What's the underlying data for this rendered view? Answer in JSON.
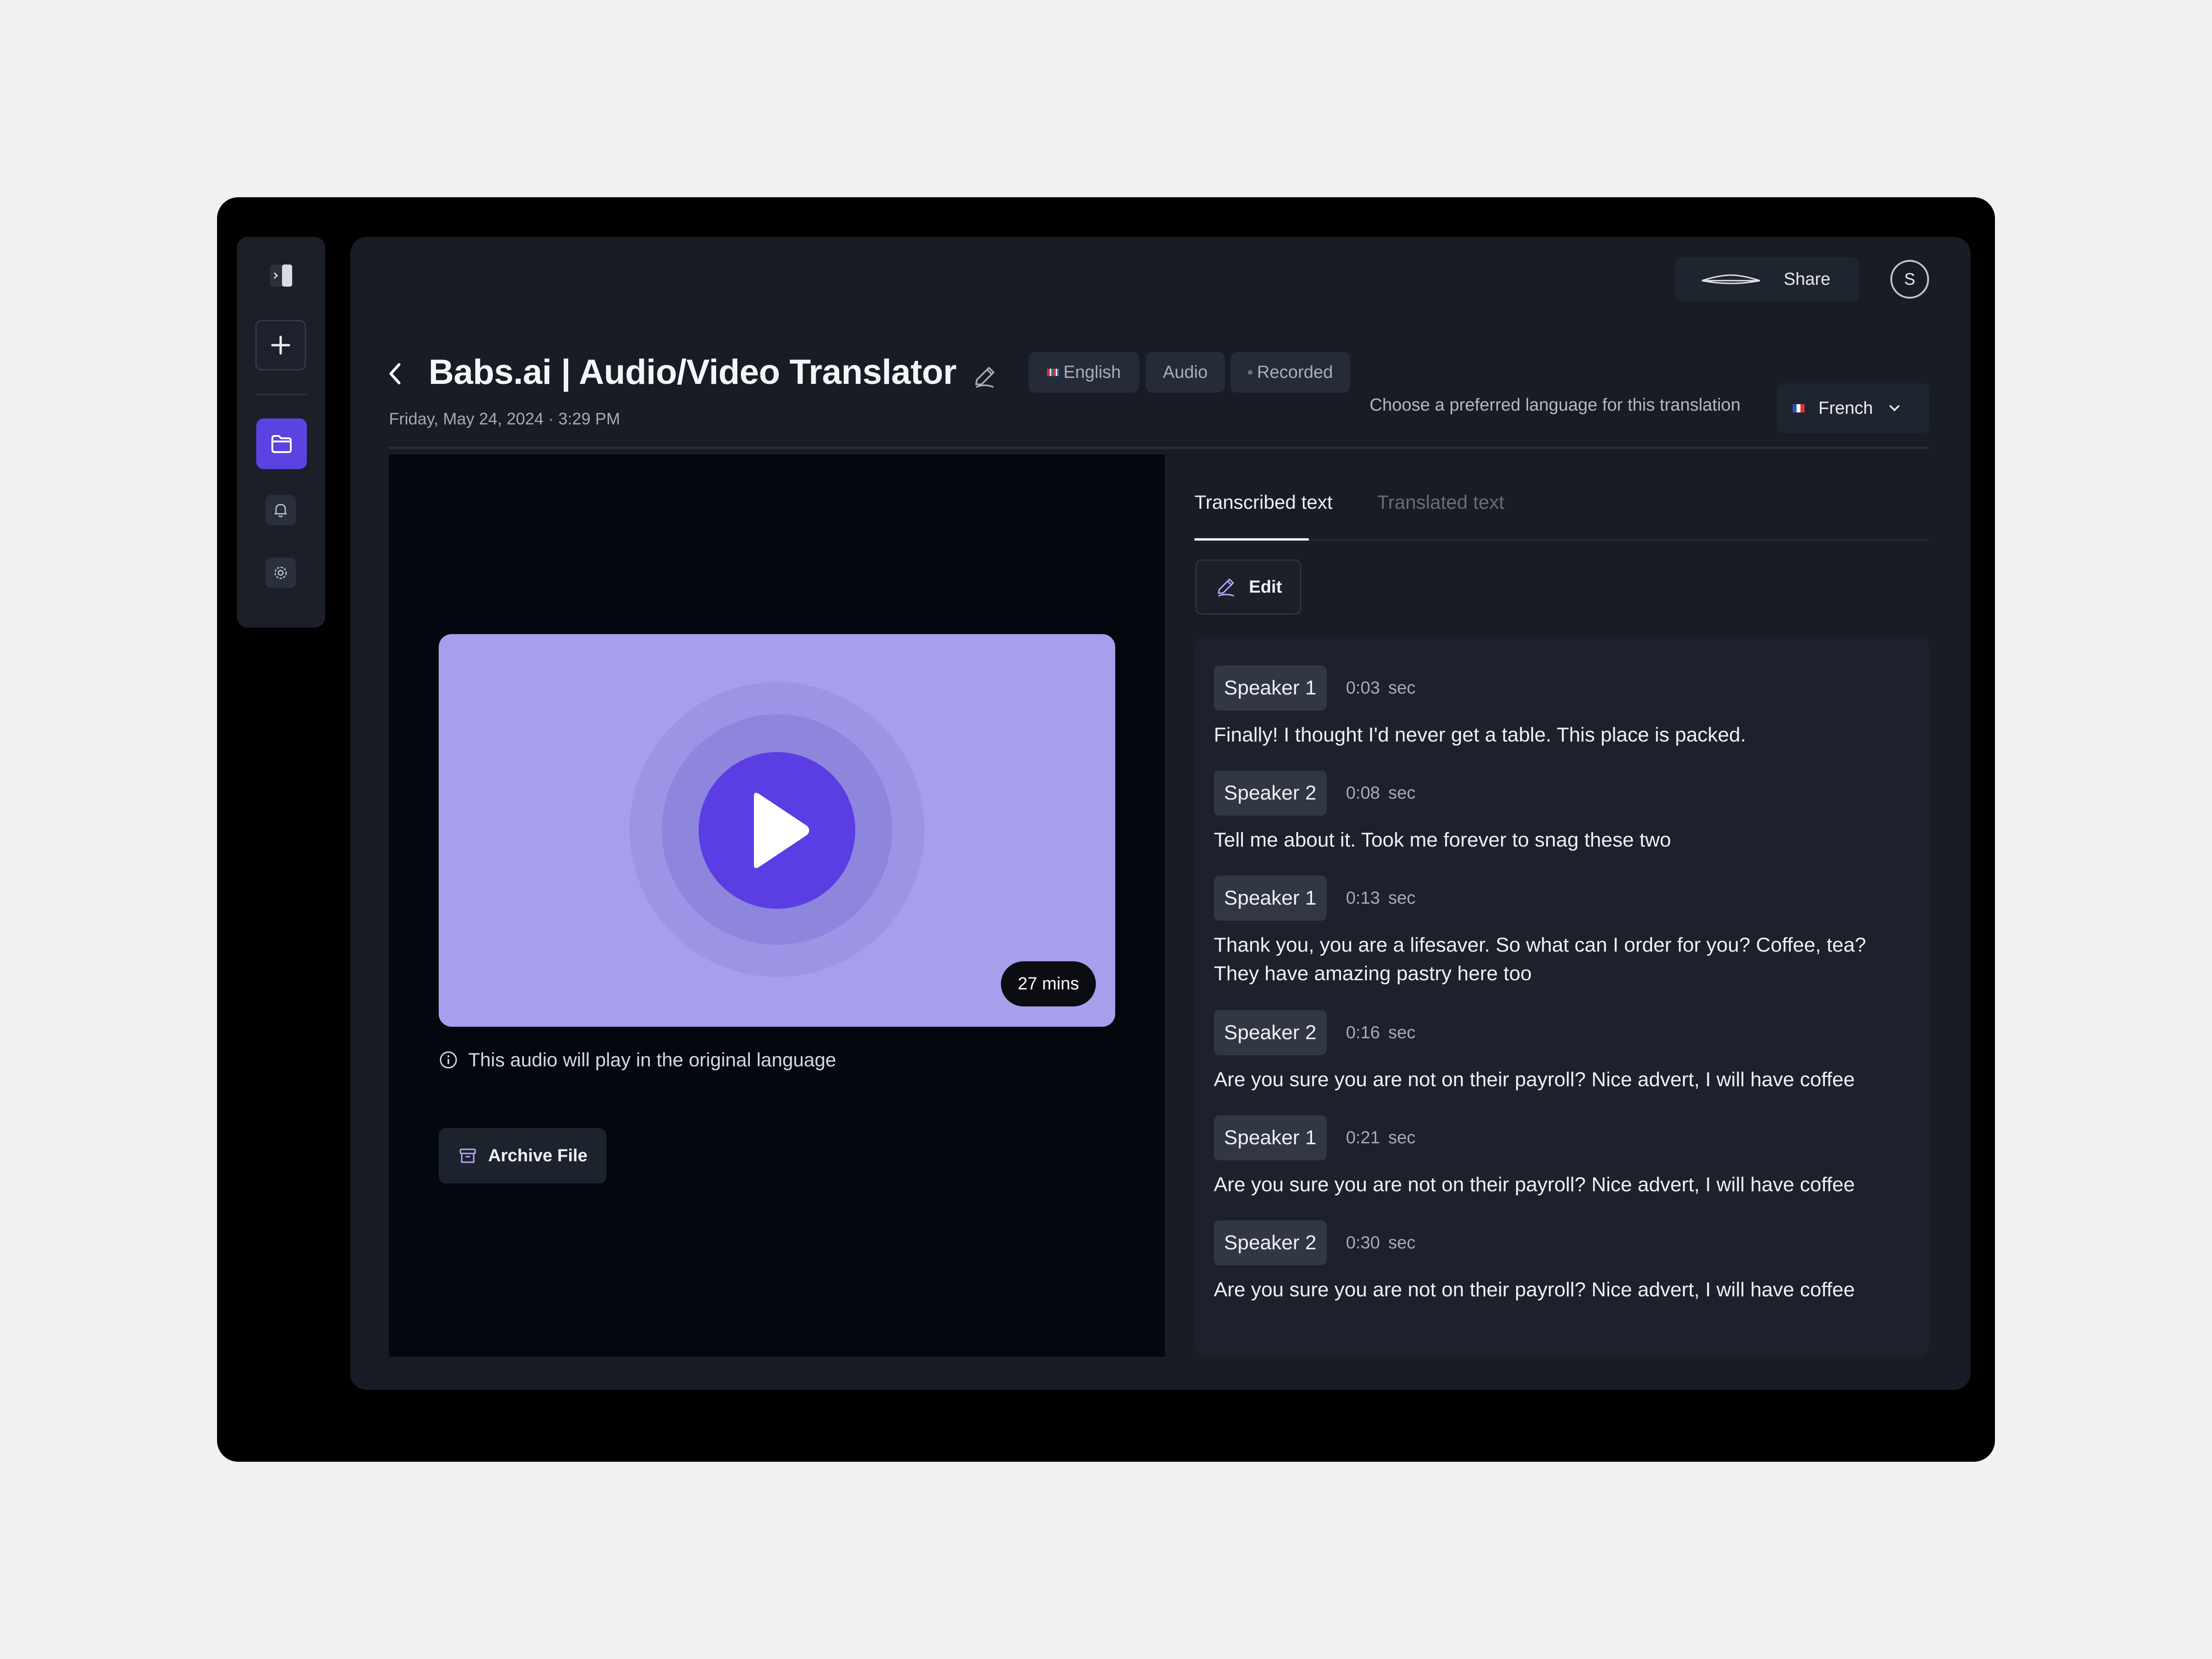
{
  "header": {
    "title": "Babs.ai | Audio/Video Translator",
    "date": "Friday, May 24, 2024 · 3:29 PM",
    "tags": {
      "language": "English",
      "media": "Audio",
      "status": "Recorded"
    },
    "share_label": "Share",
    "avatar_initial": "S",
    "preferred_language_label": "Choose a preferred language for this translation",
    "selected_language": "French"
  },
  "player": {
    "duration": "27 mins",
    "info": "This audio will play in the original language",
    "archive_label": "Archive File"
  },
  "tabs": {
    "transcribed": "Transcribed text",
    "translated": "Translated text"
  },
  "edit_label": "Edit",
  "transcript": [
    {
      "speaker": "Speaker 1",
      "time": "0:03",
      "unit": "sec",
      "text": "Finally!  I thought I'd never get a table.  This place is packed."
    },
    {
      "speaker": "Speaker 2",
      "time": "0:08",
      "unit": "sec",
      "text": "Tell me about it.  Took me forever to snag these two"
    },
    {
      "speaker": "Speaker 1",
      "time": "0:13",
      "unit": "sec",
      "text": "Thank you, you are a lifesaver. So what can I order for you? Coffee, tea? They have amazing pastry here too"
    },
    {
      "speaker": "Speaker 2",
      "time": "0:16",
      "unit": "sec",
      "text": "Are you sure you are not on their payroll? Nice advert, I will have coffee"
    },
    {
      "speaker": "Speaker 1",
      "time": "0:21",
      "unit": "sec",
      "text": "Are you sure you are not on their payroll? Nice advert, I will have coffee"
    },
    {
      "speaker": "Speaker 2",
      "time": "0:30",
      "unit": "sec",
      "text": "Are you sure you are not on their payroll? Nice advert, I will have coffee"
    }
  ],
  "colors": {
    "accent": "#5a3ee4",
    "thumbnail": "#a79fec",
    "panel": "#171c25"
  }
}
